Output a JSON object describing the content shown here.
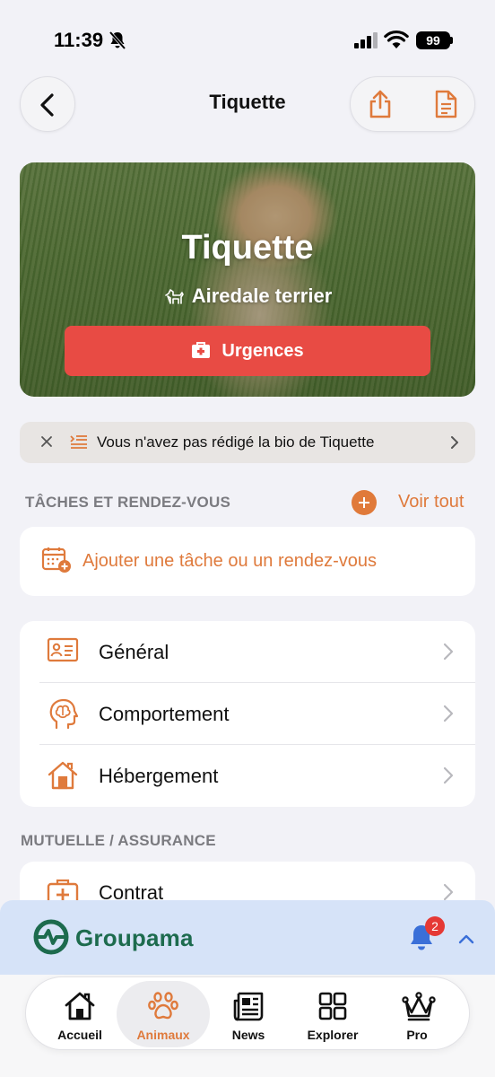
{
  "status_bar": {
    "time": "11:39",
    "battery": "99"
  },
  "nav": {
    "title": "Tiquette"
  },
  "hero": {
    "name": "Tiquette",
    "breed": "Airedale terrier",
    "emergency_label": "Urgences"
  },
  "bio_banner": {
    "text": "Vous n'avez pas rédigé la bio de Tiquette"
  },
  "tasks": {
    "heading": "TÂCHES ET RENDEZ-VOUS",
    "see_all": "Voir tout",
    "add_label": "Ajouter une tâche ou un rendez-vous"
  },
  "menu": {
    "items": [
      {
        "label": "Général"
      },
      {
        "label": "Comportement"
      },
      {
        "label": "Hébergement"
      }
    ]
  },
  "insurance": {
    "heading": "MUTUELLE / ASSURANCE",
    "contract_label": "Contrat"
  },
  "groupama": {
    "brand": "Groupama",
    "notification_count": "2"
  },
  "tabbar": {
    "items": [
      {
        "label": "Accueil"
      },
      {
        "label": "Animaux"
      },
      {
        "label": "News"
      },
      {
        "label": "Explorer"
      },
      {
        "label": "Pro"
      }
    ],
    "active": "Animaux"
  },
  "colors": {
    "accent": "#df7a3c",
    "emergency": "#e84b44",
    "brand_green": "#1d6b4e",
    "notification": "#e53935"
  }
}
